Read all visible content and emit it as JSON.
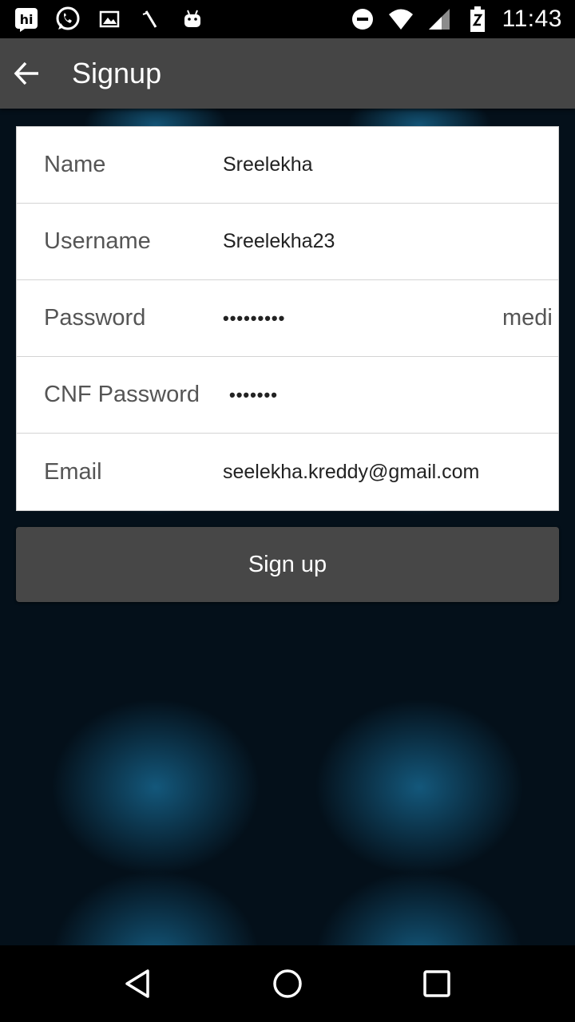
{
  "status_bar": {
    "time": "11:43",
    "left_icons": [
      "hike-icon",
      "whatsapp-icon",
      "gallery-icon",
      "tools-icon",
      "android-icon"
    ],
    "right_icons": [
      "do-not-disturb-icon",
      "wifi-icon",
      "signal-icon",
      "battery-icon"
    ]
  },
  "app_bar": {
    "title": "Signup"
  },
  "form": {
    "name": {
      "label": "Name",
      "value": "Sreelekha"
    },
    "username": {
      "label": "Username",
      "value": "Sreelekha23"
    },
    "password": {
      "label": "Password",
      "value": "•••••••••",
      "strength": "medi"
    },
    "cnf_password": {
      "label": "CNF Password",
      "value": "•••••••"
    },
    "email": {
      "label": "Email",
      "value": "seelekha.kreddy@gmail.com"
    }
  },
  "signup_button": {
    "label": "Sign up"
  },
  "colors": {
    "app_bar": "#454545",
    "button": "#474747",
    "background_glow": "#16648c"
  }
}
